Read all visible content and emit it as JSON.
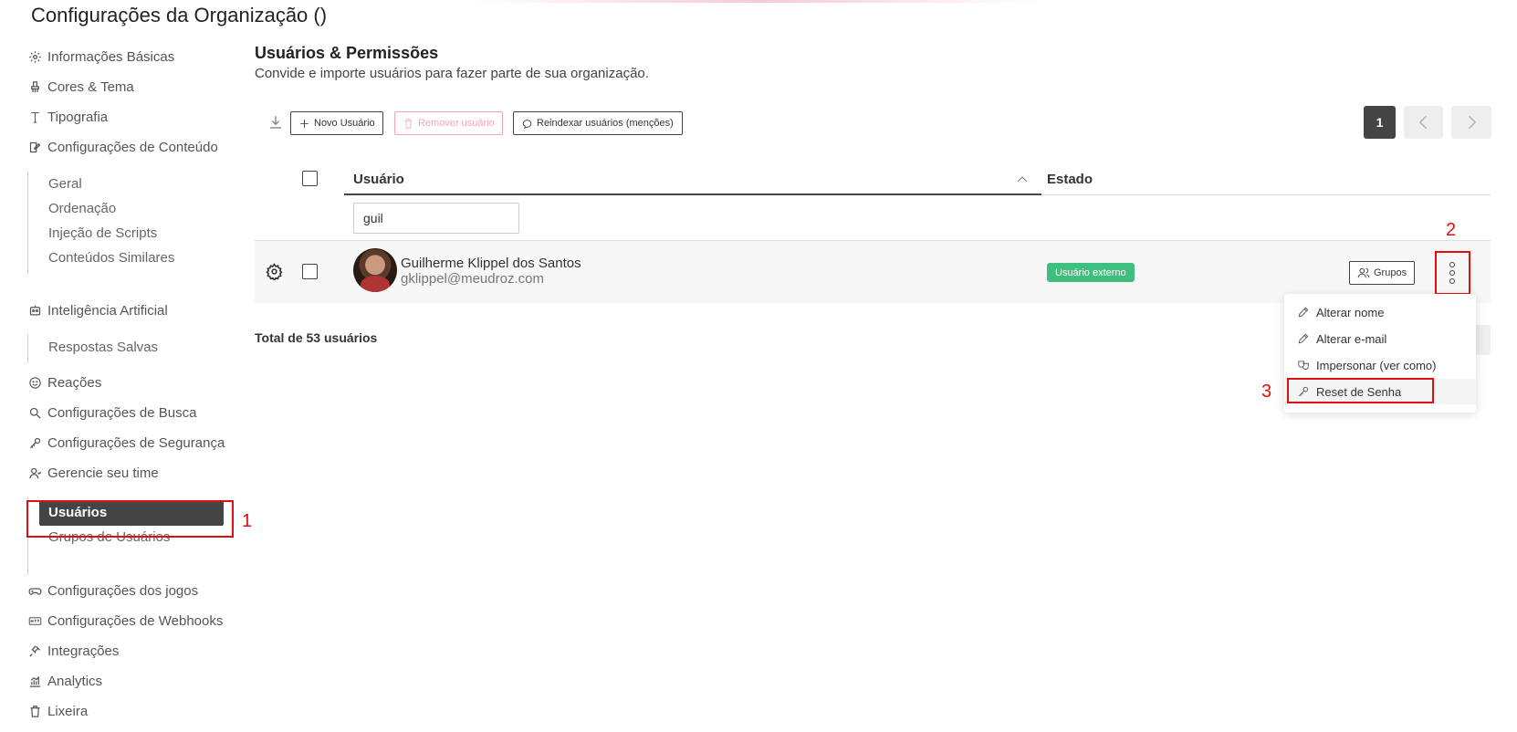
{
  "page": {
    "title": "Configurações da Organização ()"
  },
  "sidebar": {
    "items": [
      {
        "label": "Informações Básicas",
        "icon": "gear-icon"
      },
      {
        "label": "Cores & Tema",
        "icon": "paint-brush-icon"
      },
      {
        "label": "Tipografia",
        "icon": "text-icon"
      },
      {
        "label": "Configurações de Conteúdo",
        "icon": "edit-icon"
      },
      {
        "label": "Inteligência Artificial",
        "icon": "robot-icon"
      },
      {
        "label": "Reações",
        "icon": "smile-icon"
      },
      {
        "label": "Configurações de Busca",
        "icon": "search-icon"
      },
      {
        "label": "Configurações de Segurança",
        "icon": "key-icon"
      },
      {
        "label": "Gerencie seu time",
        "icon": "team-icon"
      },
      {
        "label": "Configurações dos jogos",
        "icon": "gamepad-icon"
      },
      {
        "label": "Configurações de Webhooks",
        "icon": "http-icon"
      },
      {
        "label": "Integrações",
        "icon": "plug-icon"
      },
      {
        "label": "Analytics",
        "icon": "chart-icon"
      },
      {
        "label": "Lixeira",
        "icon": "trash-icon"
      }
    ],
    "content_sub": [
      "Geral",
      "Ordenação",
      "Injeção de Scripts",
      "Conteúdos Similares"
    ],
    "ai_sub": [
      "Respostas Salvas"
    ],
    "team_sub": [
      "Usuários",
      "Grupos de Usuários"
    ]
  },
  "main": {
    "title": "Usuários & Permissões",
    "description": "Convide e importe usuários para fazer parte de sua organização.",
    "toolbar": {
      "new_user": "Novo Usuário",
      "remove_user": "Remover usuário",
      "reindex": "Reindexar usuários (menções)"
    },
    "pagination": {
      "current": "1"
    },
    "table": {
      "col_user": "Usuário",
      "col_state": "Estado",
      "filter_value": "guil",
      "rows": [
        {
          "name": "Guilherme Klippel dos Santos",
          "email": "gklippel@meudroz.com",
          "state": "Usuário externo",
          "groups_label": "Grupos"
        }
      ]
    },
    "total": "Total de 53 usuários"
  },
  "context_menu": {
    "items": [
      {
        "label": "Alterar nome",
        "icon": "pencil-icon"
      },
      {
        "label": "Alterar e-mail",
        "icon": "pencil-icon"
      },
      {
        "label": "Impersonar (ver como)",
        "icon": "mask-icon"
      },
      {
        "label": "Reset de Senha",
        "icon": "key-icon"
      }
    ]
  },
  "annotations": [
    "1",
    "2",
    "3"
  ],
  "colors": {
    "accent_dark": "#444444",
    "badge_green": "#3fbf7f",
    "annotation_red": "#e01010",
    "disabled_pink": "#f2a6b5"
  }
}
